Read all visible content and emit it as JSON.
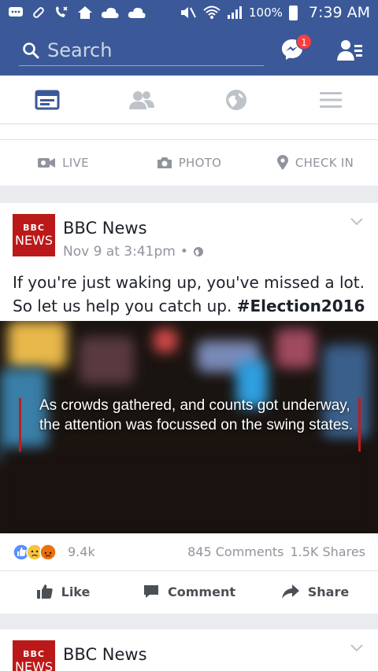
{
  "status_bar": {
    "battery": "100%",
    "time": "7:39 AM"
  },
  "search": {
    "placeholder": "Search",
    "messenger_badge": "1"
  },
  "tabs": [
    {
      "name": "news-feed",
      "active": true
    },
    {
      "name": "friends",
      "active": false
    },
    {
      "name": "notifications",
      "active": false
    },
    {
      "name": "menu",
      "active": false
    }
  ],
  "composer": {
    "live_label": "LIVE",
    "photo_label": "PHOTO",
    "checkin_label": "CHECK IN"
  },
  "post": {
    "page_logo_line1": "BBC",
    "page_logo_line2": "NEWS",
    "page_name": "BBC News",
    "timestamp": "Nov 9 at 3:41pm",
    "text_line1": "If you're just waking up, you've missed a lot.",
    "text_line2_plain": "So let us help you catch up. ",
    "hashtag": "#Election2016",
    "video_caption": "As crowds gathered, and counts got underway, the attention was focussed on the swing states.",
    "reaction_count": "9.4k",
    "comments": "845 Comments",
    "shares": "1.5K Shares",
    "like_label": "Like",
    "comment_label": "Comment",
    "share_label": "Share"
  },
  "post2": {
    "page_logo_line1": "BBC",
    "page_logo_line2": "NEWS",
    "page_name": "BBC News"
  },
  "colors": {
    "brand": "#3b5998",
    "bbc_red": "#bb1919",
    "badge": "#fa3e3e"
  }
}
